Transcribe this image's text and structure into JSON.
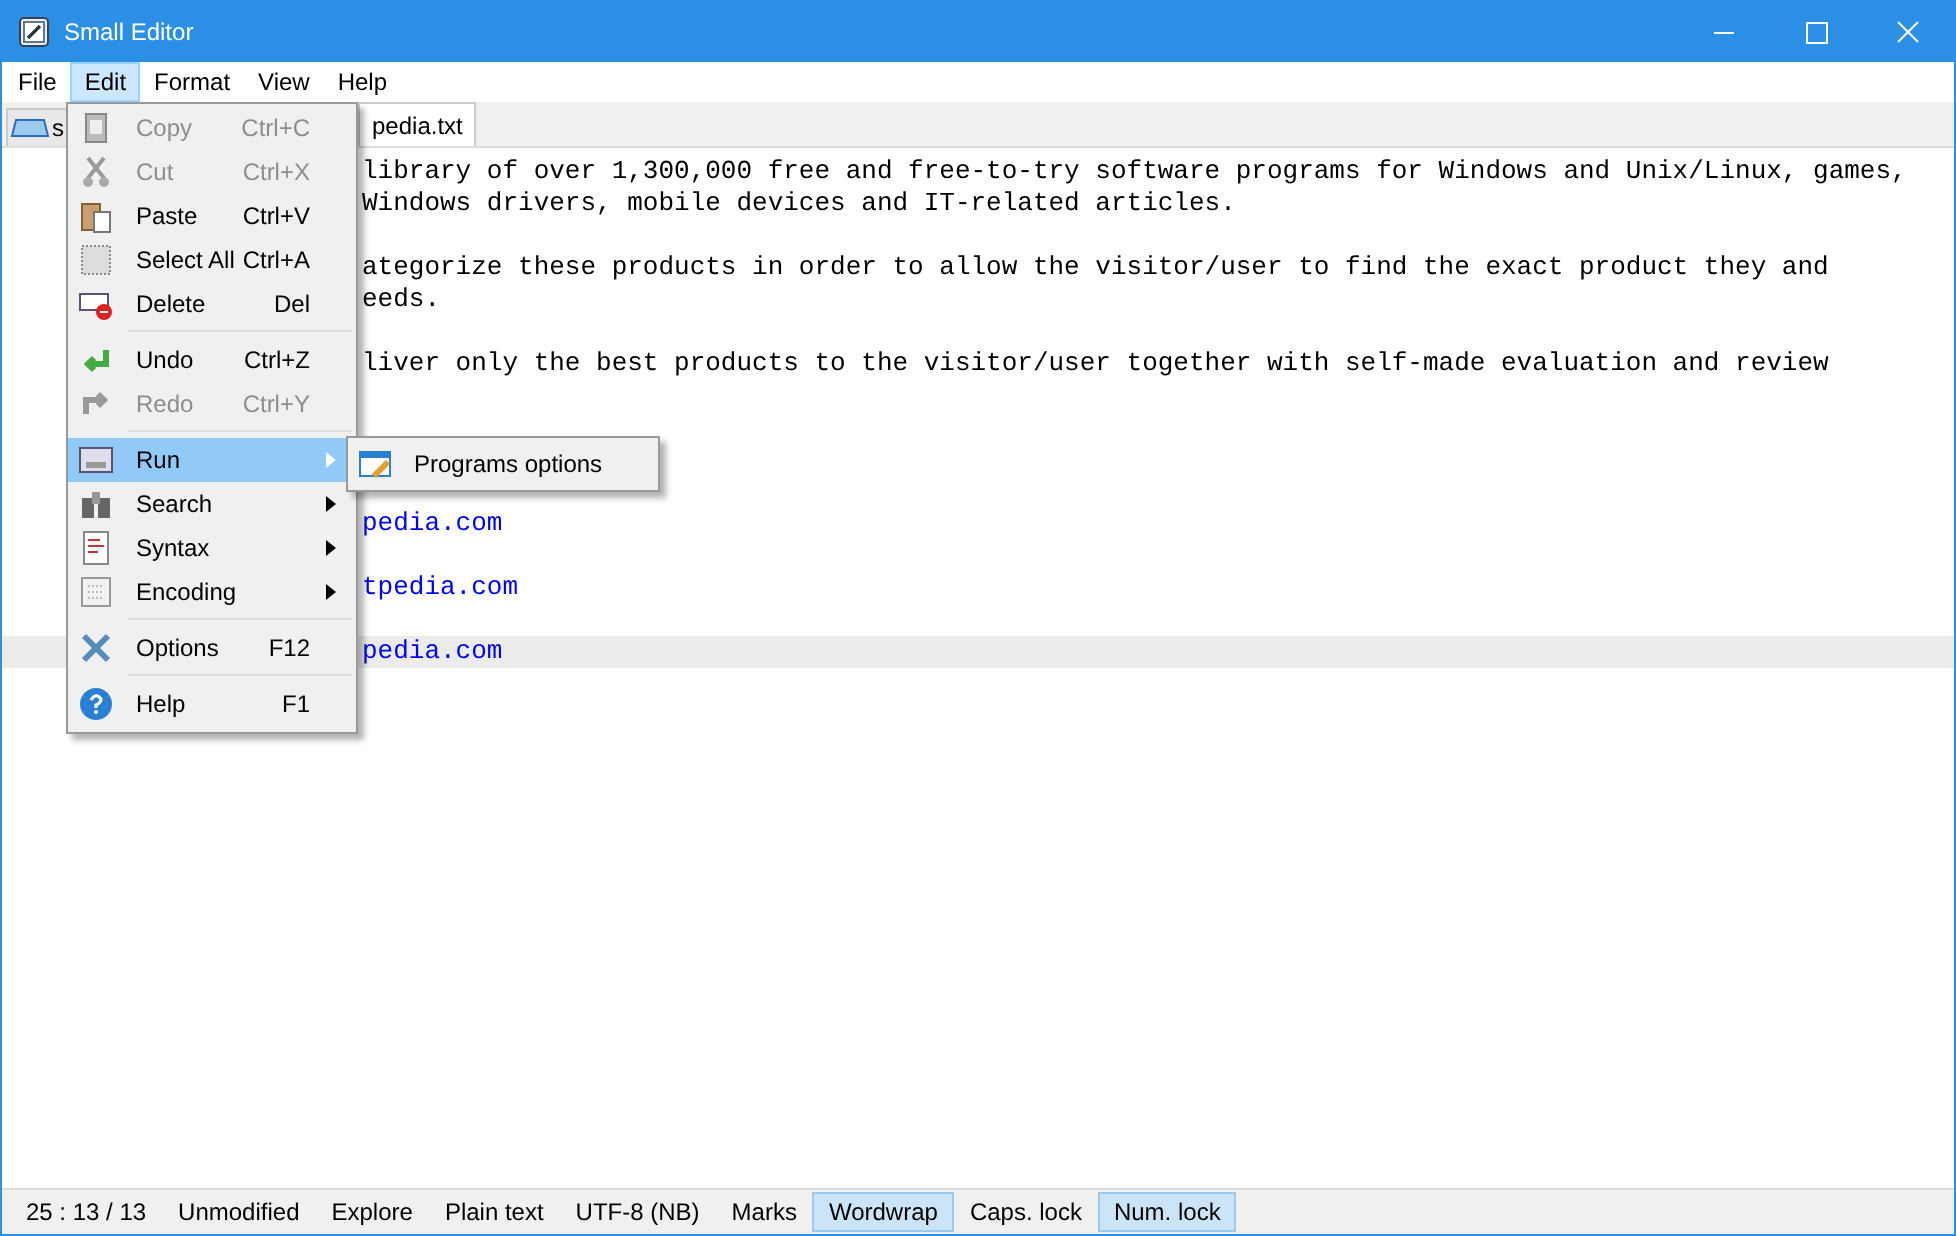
{
  "window": {
    "title": "Small Editor"
  },
  "menu_bar": [
    {
      "label": "File",
      "selected": false
    },
    {
      "label": "Edit",
      "selected": true
    },
    {
      "label": "Format",
      "selected": false
    },
    {
      "label": "View",
      "selected": false
    },
    {
      "label": "Help",
      "selected": false
    }
  ],
  "tabs": [
    {
      "label": "s",
      "selected": false
    },
    {
      "label": "pedia.txt",
      "selected": true
    }
  ],
  "editor": {
    "lines": [
      {
        "kind": "text",
        "text": "library of over 1,300,000 free and free-to-try software programs for Windows and Unix/Linux, games,",
        "current": false
      },
      {
        "kind": "text",
        "text": "Windows drivers, mobile devices and IT-related articles.",
        "current": false
      },
      {
        "kind": "blank",
        "current": false
      },
      {
        "kind": "text",
        "text": "ategorize these products in order to allow the visitor/user to find the exact product they and",
        "current": false
      },
      {
        "kind": "text",
        "text": "eeds.",
        "current": false
      },
      {
        "kind": "blank",
        "current": false
      },
      {
        "kind": "text",
        "text": "liver only the best products to the visitor/user together with self-made evaluation and review",
        "current": false
      },
      {
        "kind": "blank",
        "current": false
      },
      {
        "kind": "blank",
        "current": false
      },
      {
        "kind": "blank",
        "current": false
      },
      {
        "kind": "blank",
        "current": false
      },
      {
        "kind": "link",
        "text": "pedia.com",
        "current": false
      },
      {
        "kind": "blank",
        "current": false
      },
      {
        "kind": "link",
        "text": "tpedia.com",
        "current": false
      },
      {
        "kind": "blank",
        "current": false
      },
      {
        "kind": "link",
        "text": "pedia.com",
        "current": true
      }
    ]
  },
  "edit_menu": [
    {
      "kind": "item",
      "label": "Copy",
      "shortcut": "Ctrl+C",
      "disabled": true,
      "selected": false,
      "submenu": false
    },
    {
      "kind": "item",
      "label": "Cut",
      "shortcut": "Ctrl+X",
      "disabled": true,
      "selected": false,
      "submenu": false
    },
    {
      "kind": "item",
      "label": "Paste",
      "shortcut": "Ctrl+V",
      "disabled": false,
      "selected": false,
      "submenu": false
    },
    {
      "kind": "item",
      "label": "Select All",
      "shortcut": "Ctrl+A",
      "disabled": false,
      "selected": false,
      "submenu": false
    },
    {
      "kind": "item",
      "label": "Delete",
      "shortcut": "Del",
      "disabled": false,
      "selected": false,
      "submenu": false
    },
    {
      "kind": "separator"
    },
    {
      "kind": "item",
      "label": "Undo",
      "shortcut": "Ctrl+Z",
      "disabled": false,
      "selected": false,
      "submenu": false
    },
    {
      "kind": "item",
      "label": "Redo",
      "shortcut": "Ctrl+Y",
      "disabled": true,
      "selected": false,
      "submenu": false
    },
    {
      "kind": "separator"
    },
    {
      "kind": "item",
      "label": "Run",
      "disabled": false,
      "selected": true,
      "submenu": true
    },
    {
      "kind": "item",
      "label": "Search",
      "disabled": false,
      "selected": false,
      "submenu": true
    },
    {
      "kind": "item",
      "label": "Syntax",
      "disabled": false,
      "selected": false,
      "submenu": true
    },
    {
      "kind": "item",
      "label": "Encoding",
      "disabled": false,
      "selected": false,
      "submenu": true
    },
    {
      "kind": "separator"
    },
    {
      "kind": "item",
      "label": "Options",
      "shortcut": "F12",
      "disabled": false,
      "selected": false,
      "submenu": false
    },
    {
      "kind": "separator"
    },
    {
      "kind": "item",
      "label": "Help",
      "shortcut": "F1",
      "disabled": false,
      "selected": false,
      "submenu": false
    }
  ],
  "submenu": [
    {
      "label": "Programs options"
    }
  ],
  "status_bar": [
    {
      "text": "25 : 13 / 13",
      "on": false
    },
    {
      "text": "Unmodified",
      "on": false
    },
    {
      "text": "Explore",
      "on": false
    },
    {
      "text": "Plain text",
      "on": false
    },
    {
      "text": "UTF-8 (NB)",
      "on": false
    },
    {
      "text": "Marks",
      "on": false
    },
    {
      "text": "Wordwrap",
      "on": true
    },
    {
      "text": "Caps. lock",
      "on": false
    },
    {
      "text": "Num. lock",
      "on": true
    }
  ]
}
